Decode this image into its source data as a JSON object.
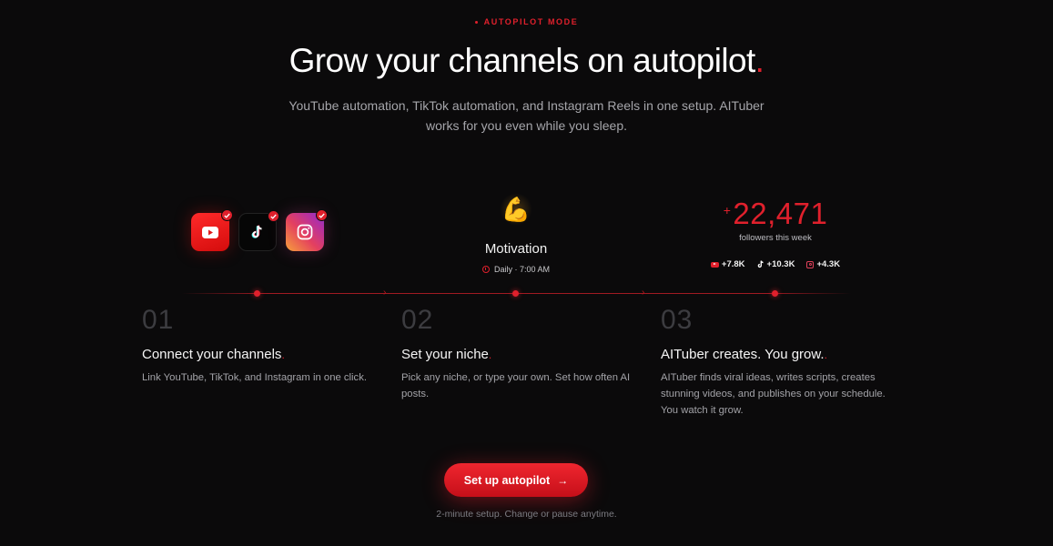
{
  "eyebrow": "AUTOPILOT MODE",
  "title": {
    "main": "Grow your channels on autopilot",
    "accent": "."
  },
  "subtitle": "YouTube automation, TikTok automation, and Instagram Reels in one setup. AITuber works for you even while you sleep.",
  "platforms": [
    {
      "name": "YouTube",
      "icon": "youtube-icon",
      "connected": true
    },
    {
      "name": "TikTok",
      "icon": "tiktok-icon",
      "connected": true
    },
    {
      "name": "Instagram",
      "icon": "instagram-icon",
      "connected": true
    }
  ],
  "motivation": {
    "emoji": "💪",
    "label": "Motivation",
    "schedule": "Daily · 7:00 AM"
  },
  "followers": {
    "prefix": "+",
    "count": "22,471",
    "label": "followers this week",
    "breakdown": {
      "youtube": "+7.8K",
      "tiktok": "+10.3K",
      "instagram": "+4.3K"
    }
  },
  "steps": [
    {
      "num": "01",
      "title": "Connect your channels",
      "accent": ".",
      "desc": "Link YouTube, TikTok, and Instagram in one click."
    },
    {
      "num": "02",
      "title": "Set your niche",
      "accent": ".",
      "desc": "Pick any niche, or type your own. Set how often AI posts."
    },
    {
      "num": "03",
      "title": "AITuber creates. You grow.",
      "accent": ".",
      "desc": "AITuber finds viral ideas, writes scripts, creates stunning videos, and publishes on your schedule. You watch it grow."
    }
  ],
  "cta": {
    "label": "Set up autopilot",
    "arrow": "→"
  },
  "note": "2-minute setup. Change or pause anytime.",
  "colors": {
    "accent": "#e0202c",
    "background": "#0b0a0b"
  }
}
